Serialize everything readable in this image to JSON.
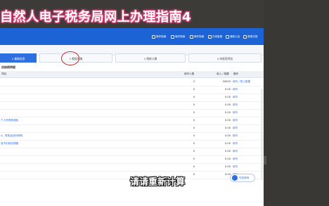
{
  "video_title": "自然人电子税务局网上办理指南4",
  "subtitle": "请请重新计算",
  "toolbar": {
    "items": [
      "操作指南",
      "操作指南",
      "操作指南",
      "在线客服",
      "通知公告",
      "政策法规"
    ]
  },
  "steps": [
    "1 基础信息",
    "2 数据采集",
    "3 税款计算",
    "4 申报表预览"
  ],
  "table": {
    "title": "应纳税明细",
    "headers": [
      "项目",
      "填写人数",
      "收入 / 税额",
      "操作"
    ],
    "rows": [
      {
        "name": "",
        "count": "2",
        "amount": "50000",
        "op": "填写 / 导入数据"
      },
      {
        "name": "",
        "count": "0",
        "amount": "0.00",
        "op": "填写"
      },
      {
        "name": "",
        "count": "0",
        "amount": "0.00",
        "op": "填写"
      },
      {
        "name": "",
        "count": "0",
        "amount": "0.00",
        "op": "填写"
      },
      {
        "name": "",
        "count": "0",
        "amount": "0.00",
        "op": "填写"
      },
      {
        "name": "个人所得税减免",
        "count": "0",
        "amount": "0.00",
        "op": "填写"
      },
      {
        "name": "",
        "count": "0",
        "amount": "0.00",
        "op": "填写"
      },
      {
        "name": "A、财政返还所得税",
        "count": "0",
        "amount": "0.00",
        "op": "填写"
      },
      {
        "name": "准予扣除的捐赠",
        "count": "0",
        "amount": "0.00",
        "op": "填写"
      },
      {
        "name": "",
        "count": "0",
        "amount": "0.00",
        "op": "填写"
      },
      {
        "name": "",
        "count": "0",
        "amount": "0.00",
        "op": "填写"
      },
      {
        "name": "",
        "count": "0",
        "amount": "0.00",
        "op": "填写"
      },
      {
        "name": "",
        "count": "0",
        "amount": "0.00",
        "op": "填写"
      }
    ]
  },
  "float_button": "在线咨询",
  "colors": {
    "brand": "#1c64d6",
    "accent": "#2d6fe0",
    "title_glow": "#e0457b"
  }
}
